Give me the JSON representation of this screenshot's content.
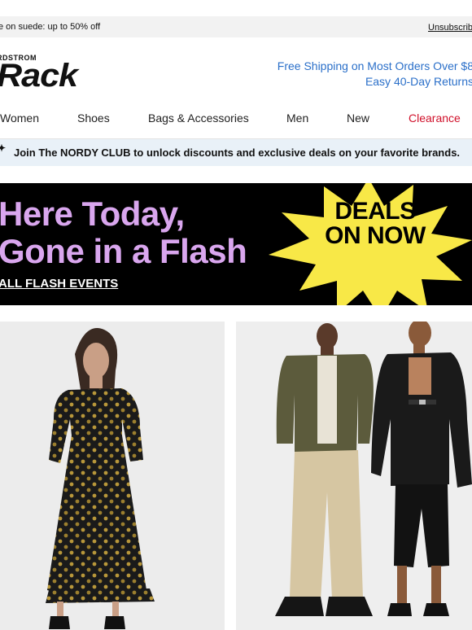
{
  "topbar": {
    "promo": "e on suede: up to 50% off",
    "unsubscribe": "Unsubscrib"
  },
  "logo": {
    "small": "RDSTROM",
    "big": "Rack"
  },
  "shipping": {
    "line1": "Free Shipping on Most Orders Over $8",
    "line2": "Easy 40-Day Returns"
  },
  "nav": {
    "items": [
      {
        "label": "Women"
      },
      {
        "label": "Shoes"
      },
      {
        "label": "Bags & Accessories"
      },
      {
        "label": "Men"
      },
      {
        "label": "New"
      },
      {
        "label": "Clearance"
      }
    ]
  },
  "club": {
    "text": "Join The NORDY CLUB to unlock discounts and exclusive deals on your favorite brands."
  },
  "flash_banner": {
    "headline_line1": "Here Today,",
    "headline_line2": "Gone in a Flash",
    "link": "ALL FLASH EVENTS",
    "burst_line1": "DEALS",
    "burst_line2": "ON NOW",
    "colors": {
      "headline": "#d9a6ee",
      "burst": "#f8e847",
      "background": "#000000"
    }
  },
  "products": [
    {
      "image": "woman-polka-dot-ruffle-dress"
    },
    {
      "image": "man-olive-shirt-khakis-woman-black-blazer"
    }
  ],
  "colors": {
    "accent_link": "#2a6fc9",
    "clearance": "#d0102a",
    "club_bg": "#e9f1f8"
  }
}
